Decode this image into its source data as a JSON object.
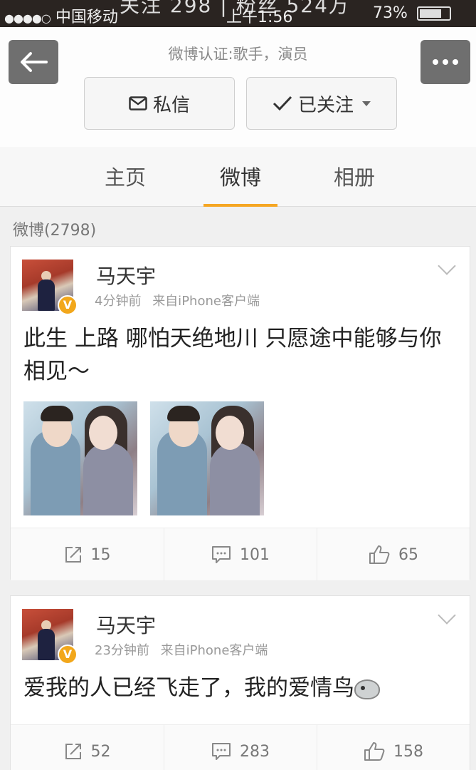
{
  "status_bar": {
    "dots": "●●●●○",
    "carrier": "中国移动",
    "time": "上午1:56",
    "battery": "73%",
    "overlay": "关注  298  |  粉丝  524万"
  },
  "header": {
    "certification": "微博认证:歌手，演员",
    "message_label": "私信",
    "follow_label": "已关注"
  },
  "tabs": [
    {
      "label": "主页"
    },
    {
      "label": "微博"
    },
    {
      "label": "相册"
    }
  ],
  "weibo_count": "微博(2798)",
  "posts": [
    {
      "author": "马天宇",
      "time": "4分钟前",
      "source": "来自iPhone客户端",
      "text": "此生 上路 哪怕天绝地川  只愿途中能够与你相见～",
      "reposts": "15",
      "comments": "101",
      "likes": "65"
    },
    {
      "author": "马天宇",
      "time": "23分钟前",
      "source": "来自iPhone客户端",
      "text": "爱我的人已经飞走了，我的爱情鸟",
      "reposts": "52",
      "comments": "283",
      "likes": "158"
    }
  ],
  "icons": {
    "back": "arrow-left-icon",
    "more": "more-icon",
    "mail": "mail-icon",
    "check": "check-icon",
    "repost": "repost-icon",
    "comment": "comment-icon",
    "like": "thumbs-up-icon",
    "verified": "verified-badge-icon"
  },
  "colors": {
    "accent": "#f5a623",
    "verified": "#f2a71b",
    "status_bar": "#2a2421"
  }
}
